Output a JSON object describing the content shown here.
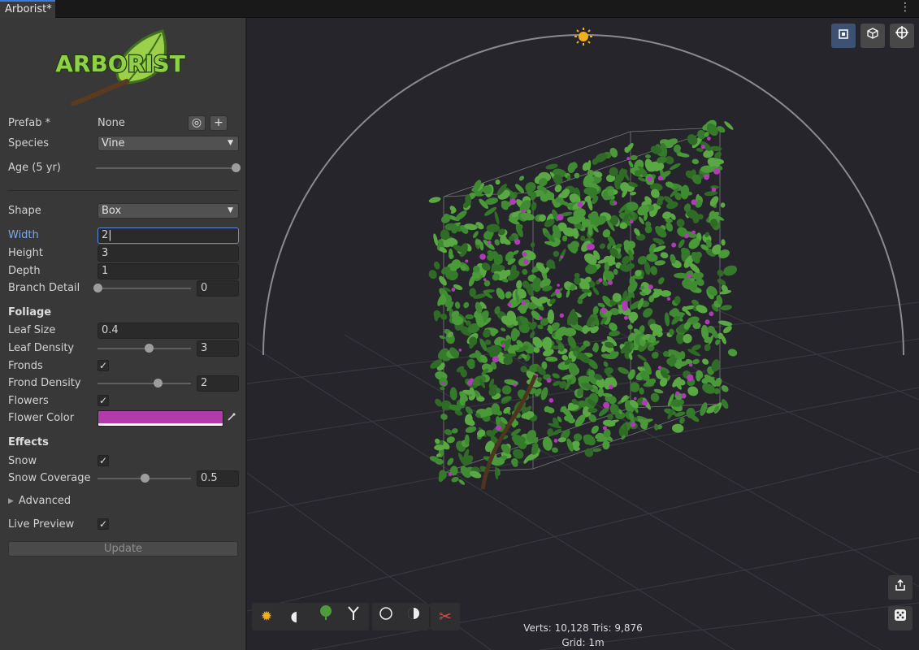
{
  "tab": {
    "title": "Arborist*"
  },
  "logo": {
    "text": "ARBORIST"
  },
  "inspector": {
    "prefab_label": "Prefab *",
    "prefab_value": "None",
    "prefab_add": "+",
    "species_label": "Species",
    "species_value": "Vine",
    "age_label": "Age (5 yr)",
    "age_level": 1.0,
    "shape_label": "Shape",
    "shape_value": "Box",
    "width_label": "Width",
    "width_value": "2",
    "height_label": "Height",
    "height_value": "3",
    "depth_label": "Depth",
    "depth_value": "1",
    "branch_detail_label": "Branch Detail",
    "branch_detail_value": "0",
    "branch_detail_level": 0.0,
    "foliage_header": "Foliage",
    "leaf_size_label": "Leaf Size",
    "leaf_size_value": "0.4",
    "leaf_density_label": "Leaf Density",
    "leaf_density_value": "3",
    "leaf_density_level": 0.55,
    "fronds_label": "Fronds",
    "fronds_checked": "✓",
    "frond_density_label": "Frond Density",
    "frond_density_value": "2",
    "frond_density_level": 0.64,
    "flowers_label": "Flowers",
    "flowers_checked": "✓",
    "flower_color_label": "Flower Color",
    "flower_color": "#b23aa9",
    "effects_header": "Effects",
    "snow_label": "Snow",
    "snow_checked": "✓",
    "snow_coverage_label": "Snow Coverage",
    "snow_coverage_value": "0.5",
    "snow_coverage_level": 0.5,
    "advanced_label": "Advanced",
    "live_preview_label": "Live Preview",
    "live_preview_checked": "✓",
    "update_label": "Update"
  },
  "viewport": {
    "stats": "Verts: 10,128   Tris: 9,876",
    "grid": "Grid: 1m",
    "top_tools": [
      "frame-icon",
      "cube-icon",
      "crosshair-icon"
    ],
    "bottom_tools": [
      "sun-icon",
      "half-moon-icon",
      "tree-icon",
      "branch-icon",
      "circle-icon",
      "contrast-icon",
      "scissors-icon"
    ],
    "colors": {
      "leaf": "#3f8a32",
      "flower": "#b03cb5",
      "accent": "#3b78e0",
      "sun": "#f0b01e"
    }
  }
}
